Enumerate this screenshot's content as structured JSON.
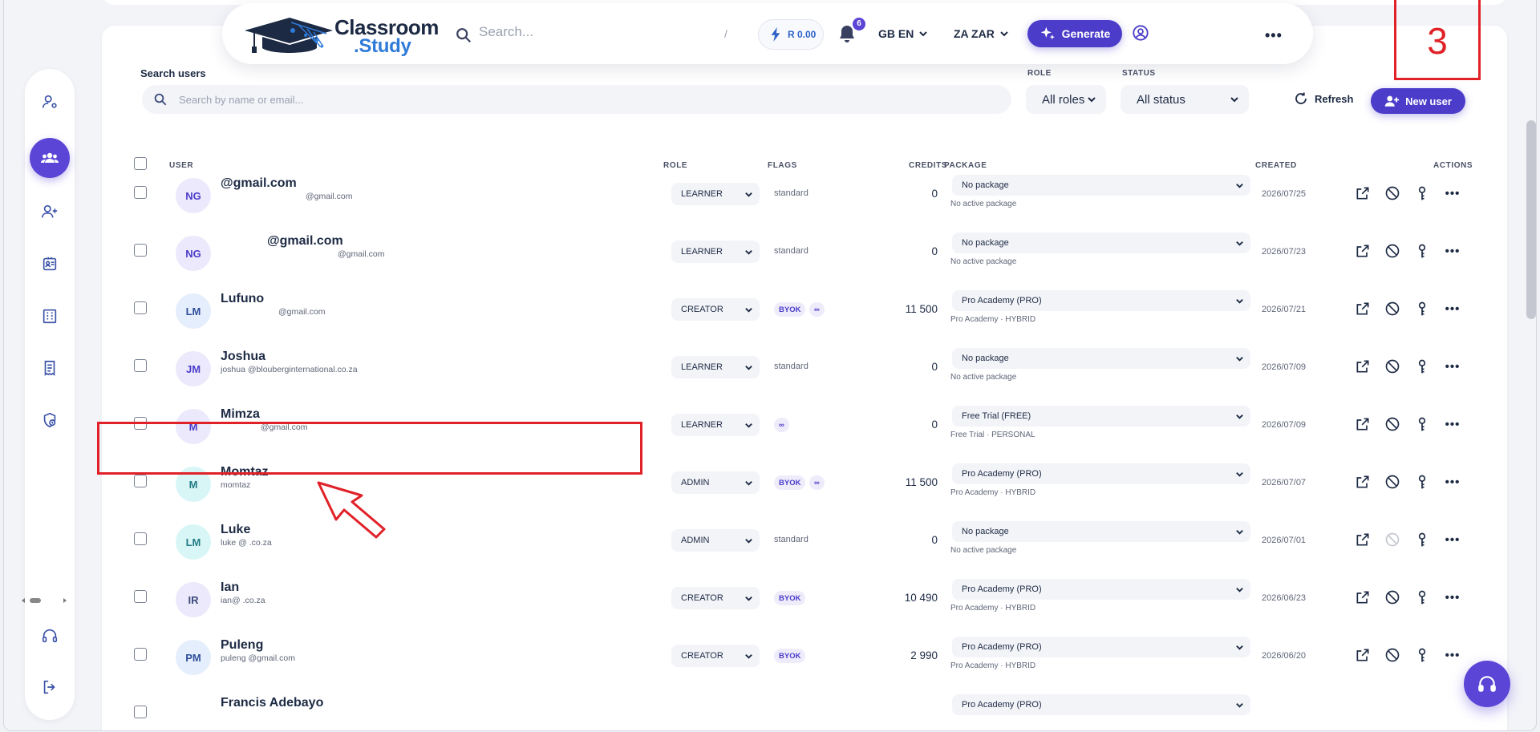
{
  "header": {
    "logo_line1": "Classroom",
    "logo_line2": ".Study",
    "search_placeholder": "Search...",
    "search_shortcut": "/",
    "credit_balance": "R 0.00",
    "notification_count": "6",
    "language": "GB EN",
    "currency": "ZA ZAR",
    "generate_label": "Generate",
    "more_label": "•••"
  },
  "toolbar": {
    "search_label": "Search users",
    "search_placeholder": "Search by name or email...",
    "role_label": "ROLE",
    "role_value": "All roles",
    "status_label": "STATUS",
    "status_value": "All status",
    "refresh_label": "Refresh",
    "new_user_label": "New user"
  },
  "table": {
    "columns": {
      "user": "USER",
      "role": "ROLE",
      "flags": "FLAGS",
      "credits": "CREDITS",
      "package": "PACKAGE",
      "created": "CREATED",
      "actions": "ACTIONS"
    },
    "rows": [
      {
        "initials": "NG",
        "name": "@gmail.com",
        "email": "@gmail.com",
        "role": "LEARNER",
        "flags_text": "standard",
        "badges": [],
        "credits": "0",
        "package": "No package",
        "package_sub": "No active package",
        "created": "2026/07/25"
      },
      {
        "initials": "NG",
        "name": "@gmail.com",
        "email": "@gmail.com",
        "role": "LEARNER",
        "flags_text": "standard",
        "badges": [],
        "credits": "0",
        "package": "No package",
        "package_sub": "No active package",
        "created": "2026/07/23"
      },
      {
        "initials": "LM",
        "name": "Lufuno",
        "email": "@gmail.com",
        "role": "CREATOR",
        "flags_text": "",
        "badges": [
          "BYOK",
          "∞"
        ],
        "credits": "11 500",
        "package": "Pro Academy (PRO)",
        "package_sub": "Pro Academy · HYBRID",
        "created": "2026/07/21"
      },
      {
        "initials": "JM",
        "name": "Joshua",
        "email": "joshua          @blouberginternational.co.za",
        "role": "LEARNER",
        "flags_text": "standard",
        "badges": [],
        "credits": "0",
        "package": "No package",
        "package_sub": "No active package",
        "created": "2026/07/09"
      },
      {
        "initials": "M",
        "name": "Mimza",
        "email": "@gmail.com",
        "role": "LEARNER",
        "flags_text": "",
        "badges": [
          "∞"
        ],
        "credits": "0",
        "package": "Free Trial (FREE)",
        "package_sub": "Free Trial · PERSONAL",
        "created": "2026/07/09"
      },
      {
        "initials": "M",
        "name": "Momtaz",
        "email": "momtaz",
        "role": "ADMIN",
        "flags_text": "",
        "badges": [
          "BYOK",
          "∞"
        ],
        "credits": "11 500",
        "package": "Pro Academy (PRO)",
        "package_sub": "Pro Academy · HYBRID",
        "created": "2026/07/07"
      },
      {
        "initials": "LM",
        "name": "Luke",
        "email": "luke                 @              .co.za",
        "role": "ADMIN",
        "flags_text": "standard",
        "badges": [],
        "credits": "0",
        "package": "No package",
        "package_sub": "No active package",
        "created": "2026/07/01"
      },
      {
        "initials": "IR",
        "name": "Ian",
        "email": "ian@                         .co.za",
        "role": "CREATOR",
        "flags_text": "",
        "badges": [
          "BYOK"
        ],
        "credits": "10 490",
        "package": "Pro Academy (PRO)",
        "package_sub": "Pro Academy · HYBRID",
        "created": "2026/06/23"
      },
      {
        "initials": "PM",
        "name": "Puleng",
        "email": "puleng               @gmail.com",
        "role": "CREATOR",
        "flags_text": "",
        "badges": [
          "BYOK"
        ],
        "credits": "2 990",
        "package": "Pro Academy (PRO)",
        "package_sub": "Pro Academy · HYBRID",
        "created": "2026/06/20"
      },
      {
        "initials": "",
        "name": "Francis Adebayo",
        "email": "",
        "role": "",
        "flags_text": "",
        "badges": [],
        "credits": "",
        "package": "Pro Academy (PRO)",
        "package_sub": "",
        "created": ""
      }
    ]
  },
  "annotation": {
    "step_number": "3"
  },
  "colors": {
    "accent": "#4b3cc9",
    "annotation": "#e02228"
  }
}
